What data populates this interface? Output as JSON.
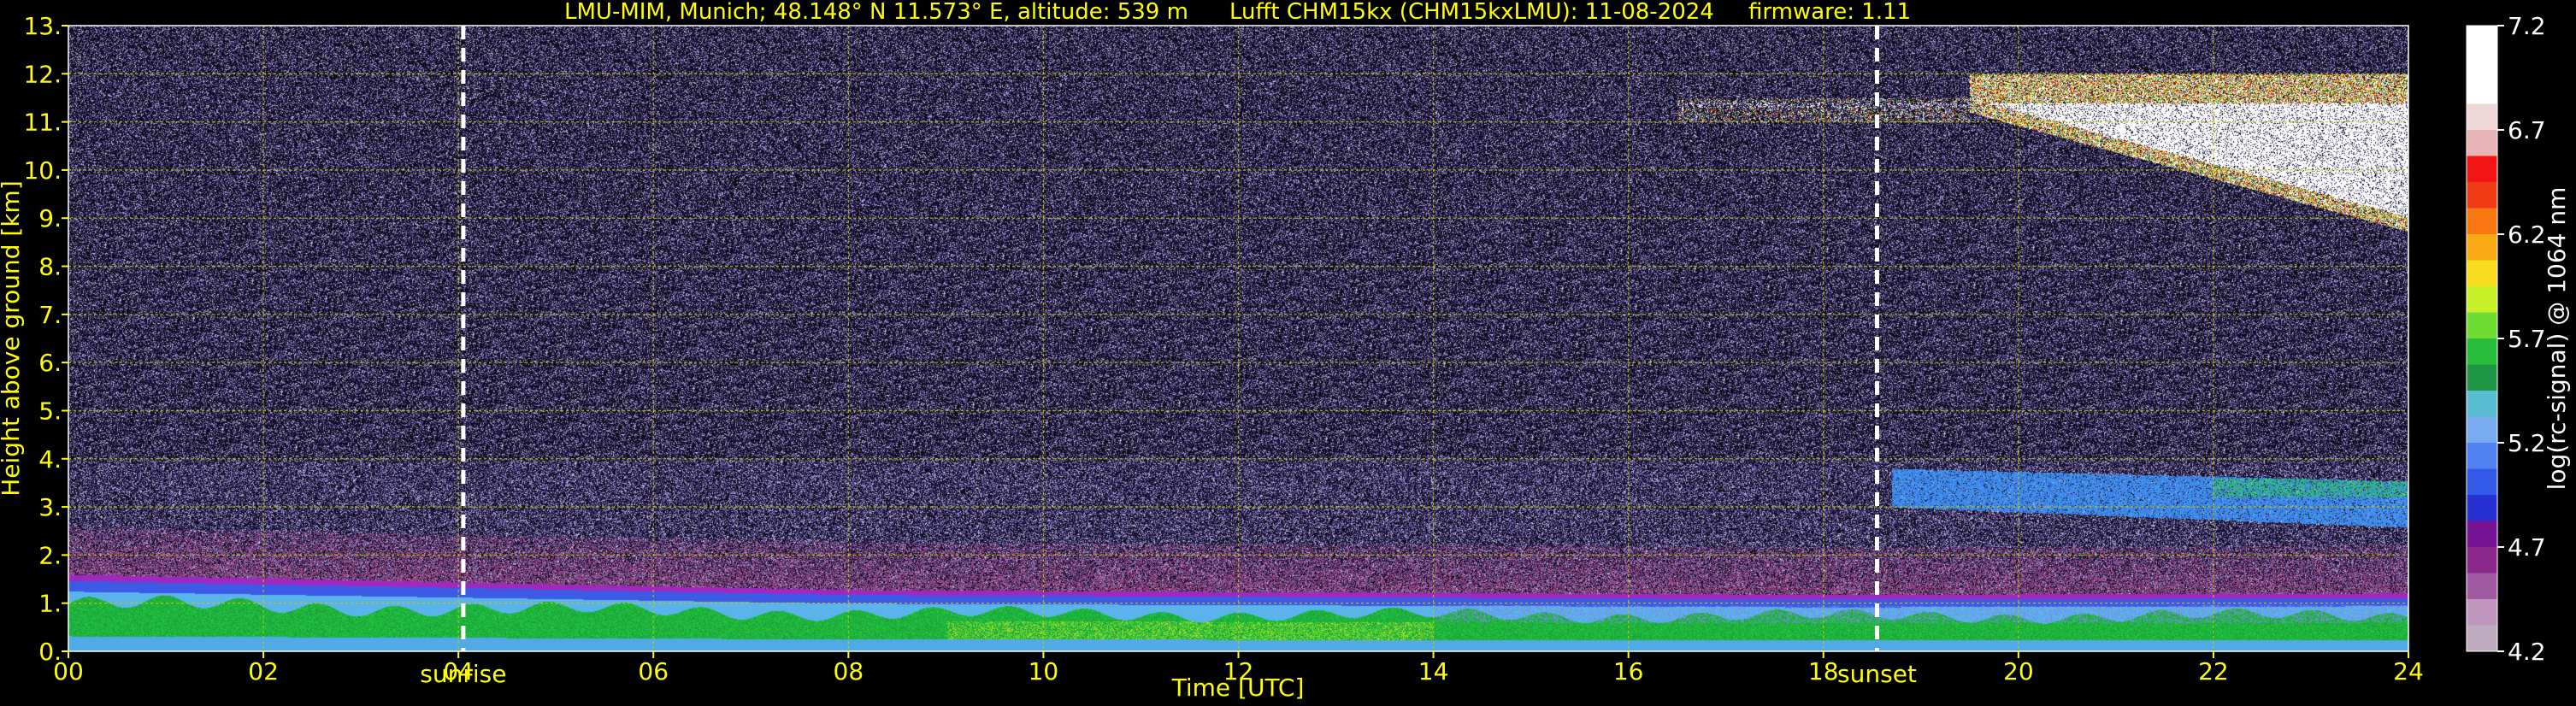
{
  "header": {
    "title_left": "LMU-MIM, Munich; 48.148° N 11.573° E, altitude: 539 m",
    "title_mid": "Lufft CHM15kx (CHM15kxLMU): 11-08-2024",
    "title_right": "firmware: 1.11"
  },
  "chart_data": {
    "type": "heatmap",
    "xlabel": "Time [UTC]",
    "ylabel": "Height above ground [km]",
    "xlim": [
      0,
      24
    ],
    "ylim": [
      0,
      13
    ],
    "x_ticks": [
      "00",
      "02",
      "04",
      "06",
      "08",
      "10",
      "12",
      "14",
      "16",
      "18",
      "20",
      "22",
      "24"
    ],
    "y_ticks": [
      "0.",
      "1.",
      "2.",
      "3.",
      "4.",
      "5.",
      "6.",
      "7.",
      "8.",
      "9.",
      "10.",
      "11.",
      "12.",
      "13."
    ],
    "grid": true,
    "markers": [
      {
        "label": "sunrise",
        "x": 4.05
      },
      {
        "label": "sunset",
        "x": 18.55
      }
    ],
    "colorbar": {
      "label": "log(rc-signal) @ 1064 nm",
      "range": [
        4.2,
        7.2
      ],
      "ticks": [
        "7.2",
        "6.7",
        "6.2",
        "5.7",
        "5.2",
        "4.7",
        "4.2"
      ]
    },
    "layers": [
      {
        "name": "boundary layer",
        "x_start": 0,
        "x_end": 24,
        "top_km": [
          1.6,
          1.3,
          1.2
        ]
      },
      {
        "name": "elevated aerosol layer",
        "x_start": 18.7,
        "x_end": 24,
        "height_km": [
          2.5,
          4.0
        ]
      },
      {
        "name": "cirrus",
        "x_start": 16.5,
        "x_end": 24,
        "height_km": [
          8.5,
          12.0
        ]
      }
    ],
    "colors": {
      "text": "#ffff00",
      "grid": "#c8c800",
      "marker": "#ffffff",
      "background_noise": "#0b0912"
    }
  }
}
